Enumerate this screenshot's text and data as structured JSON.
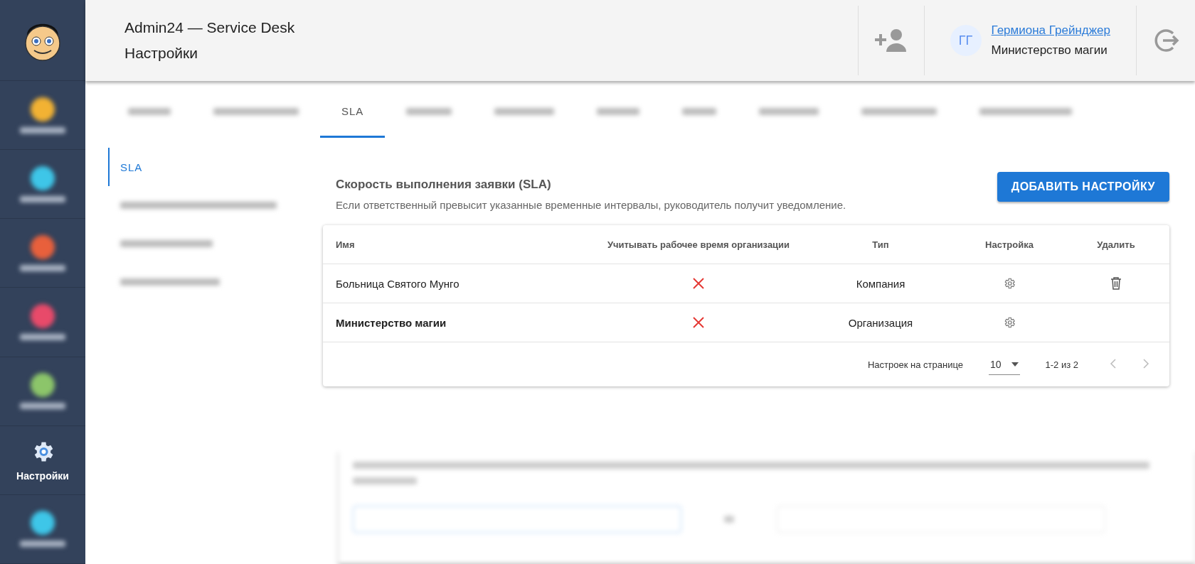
{
  "sidebar": {
    "items": [
      {
        "selected": false
      },
      {
        "selected": false
      },
      {
        "selected": false
      },
      {
        "selected": false
      },
      {
        "selected": false
      },
      {
        "label": "Настройки",
        "selected": true
      },
      {
        "selected": false
      }
    ]
  },
  "header": {
    "app_title": "Admin24 — Service Desk",
    "page_title": "Настройки",
    "user": {
      "initials": "ГГ",
      "name": "Гермиона Грейнджер",
      "organization": "Министерство магии"
    }
  },
  "tabs": [
    {
      "selected": false
    },
    {
      "selected": false
    },
    {
      "label": "SLA",
      "selected": true
    },
    {
      "selected": false
    },
    {
      "selected": false
    },
    {
      "selected": false
    },
    {
      "selected": false
    },
    {
      "selected": false
    },
    {
      "selected": false
    },
    {
      "selected": false
    }
  ],
  "subnav": [
    {
      "label": "SLA",
      "selected": true
    },
    {
      "selected": false
    },
    {
      "selected": false
    },
    {
      "selected": false
    }
  ],
  "section": {
    "title": "Скорость выполнения заявки (SLA)",
    "description": "Если ответственный превысит указанные временные интервалы, руководитель получит уведомление.",
    "add_button": "ДОБАВИТЬ НАСТРОЙКУ"
  },
  "table": {
    "columns": [
      "Имя",
      "Учитывать рабочее время организации",
      "Тип",
      "Настройка",
      "Удалить"
    ],
    "rows": [
      {
        "name": "Больница Святого Мунго",
        "bold": false,
        "work_hours": false,
        "type": "Компания",
        "deletable": true
      },
      {
        "name": "Министерство магии",
        "bold": true,
        "work_hours": false,
        "type": "Организация",
        "deletable": false
      }
    ],
    "footer": {
      "per_page_label": "Настроек на странице",
      "per_page": "10",
      "range": "1-2 из 2",
      "prev_disabled": true,
      "next_disabled": true
    }
  }
}
